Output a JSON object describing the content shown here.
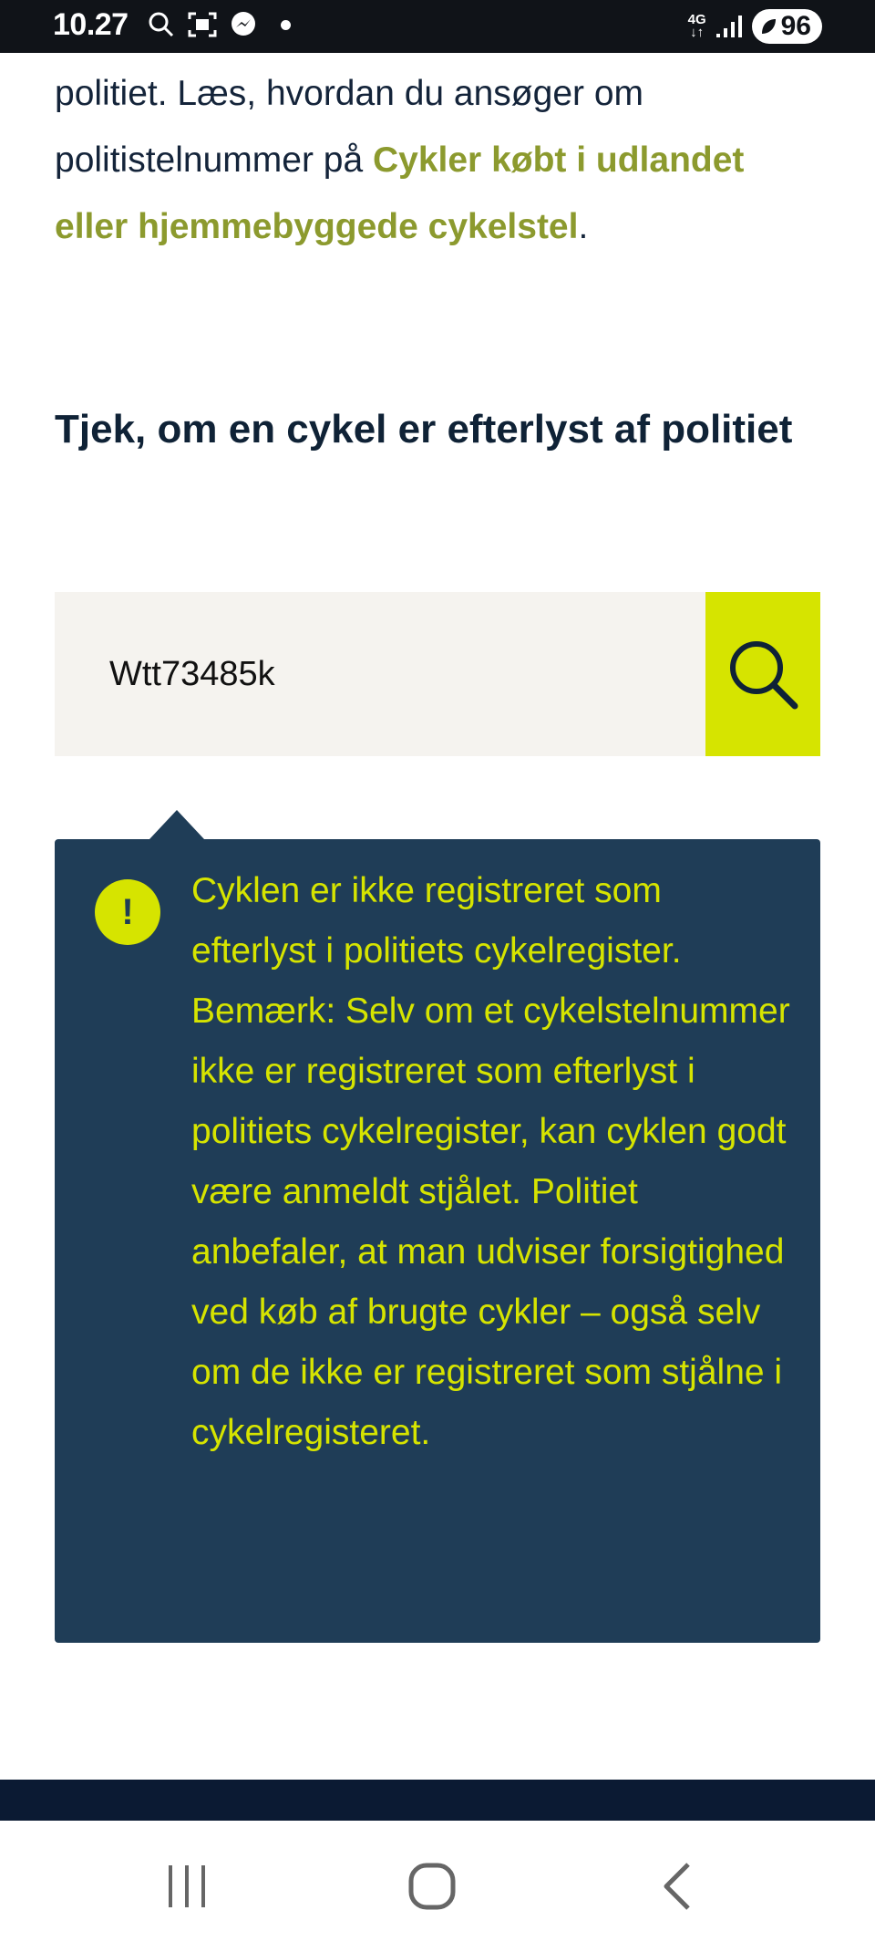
{
  "status_bar": {
    "time": "10.27",
    "network": [
      "4G",
      "↓↑"
    ],
    "battery": "96"
  },
  "intro": {
    "line1": "politiet. Læs, hvordan du ansøger om",
    "text_before_link": "politistelnummer på ",
    "link_text": "Cykler købt i udlandet eller hjemmebyggede cykelstel",
    "text_after_link": "."
  },
  "heading": "Tjek, om en cykel er efterlyst af politiet",
  "search": {
    "value": "Wtt73485k"
  },
  "result": {
    "alert_symbol": "!",
    "message": "Cyklen er ikke registreret som efterlyst i politiets cykelregister. Bemærk: Selv om et cykelstelnummer ikke er registreret som efterlyst i politiets cykelregister, kan cyklen godt være anmeldt stjålet. Politiet anbefaler, at man udviser forsigtighed ved køb af brugte cykler – også selv om de ikke er registreret som stjålne i cykelregisteret."
  },
  "colors": {
    "accent": "#d6e400",
    "result_bg": "#1f3d57",
    "link": "#8c9a2e",
    "footer": "#0b1a33"
  },
  "icons": {
    "search": "magnifier-icon",
    "alert": "exclamation-icon",
    "nav": [
      "recent-apps-icon",
      "home-icon",
      "back-icon"
    ]
  }
}
